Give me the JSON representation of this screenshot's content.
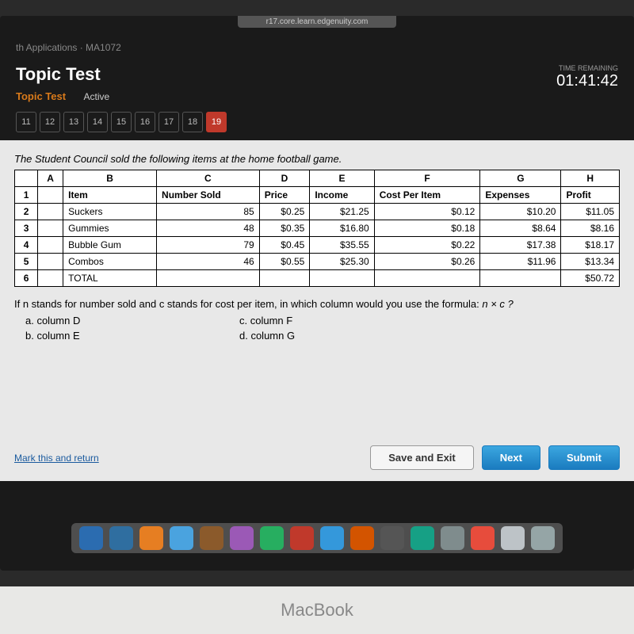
{
  "url": "r17.core.learn.edgenuity.com",
  "breadcrumb": "th Applications · MA1072",
  "header": {
    "title": "Topic Test",
    "subtitle_orange": "Topic Test",
    "subtitle_active": "Active",
    "timer_label": "TIME REMAINING",
    "timer": "01:41:42"
  },
  "nav": [
    "11",
    "12",
    "13",
    "14",
    "15",
    "16",
    "17",
    "18",
    "19"
  ],
  "nav_current": "19",
  "prompt": "The Student Council sold the following items at the home football game.",
  "table": {
    "cols": [
      "",
      "A",
      "B",
      "C",
      "D",
      "E",
      "F",
      "G",
      "H"
    ],
    "header_row": [
      "1",
      "",
      "Item",
      "Number Sold",
      "Price",
      "Income",
      "Cost Per Item",
      "Expenses",
      "Profit"
    ],
    "rows": [
      [
        "2",
        "",
        "Suckers",
        "85",
        "$0.25",
        "$21.25",
        "$0.12",
        "$10.20",
        "$11.05"
      ],
      [
        "3",
        "",
        "Gummies",
        "48",
        "$0.35",
        "$16.80",
        "$0.18",
        "$8.64",
        "$8.16"
      ],
      [
        "4",
        "",
        "Bubble Gum",
        "79",
        "$0.45",
        "$35.55",
        "$0.22",
        "$17.38",
        "$18.17"
      ],
      [
        "5",
        "",
        "Combos",
        "46",
        "$0.55",
        "$25.30",
        "$0.26",
        "$11.96",
        "$13.34"
      ],
      [
        "6",
        "",
        "TOTAL",
        "",
        "",
        "",
        "",
        "",
        "$50.72"
      ]
    ]
  },
  "question": {
    "text": "If n stands for number sold and c stands for cost per item, in which column would you use the formula:",
    "formula": "n × c ?",
    "options": {
      "a": "a.    column D",
      "b": "b.    column E",
      "c": "c.    column F",
      "d": "d.    column G"
    }
  },
  "footer": {
    "mark": "Mark this and return",
    "save": "Save and Exit",
    "next": "Next",
    "submit": "Submit"
  },
  "laptop": "MacBook",
  "dock_colors": [
    "#2b6cb0",
    "#2f6ea0",
    "#e67e22",
    "#4aa3df",
    "#8b5a2b",
    "#9b59b6",
    "#27ae60",
    "#c0392b",
    "#3498db",
    "#d35400",
    "#555",
    "#16a085",
    "#7f8c8d",
    "#e74c3c",
    "#bdc3c7",
    "#95a5a6"
  ]
}
